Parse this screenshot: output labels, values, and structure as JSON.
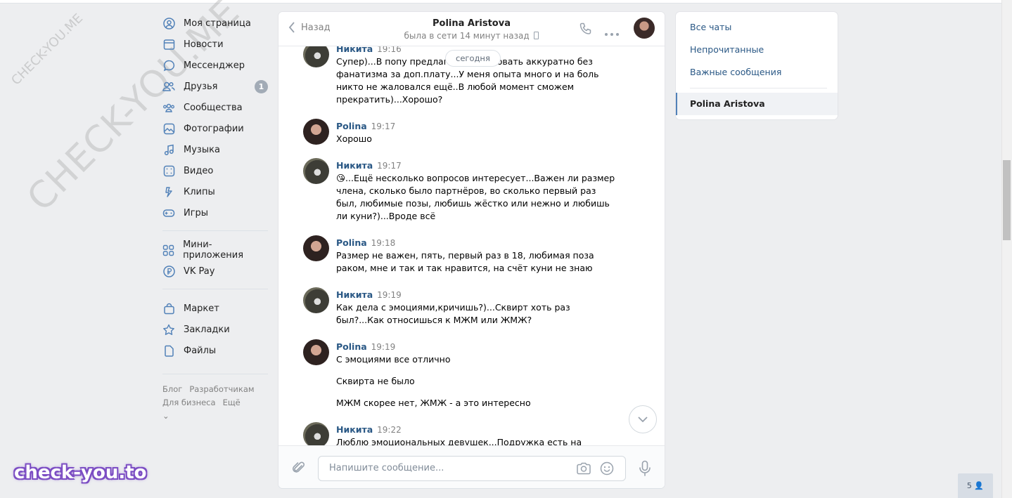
{
  "nav": {
    "items": [
      {
        "label": "Моя страница",
        "icon": "user-circle-icon"
      },
      {
        "label": "Новости",
        "icon": "newspaper-icon"
      },
      {
        "label": "Мессенджер",
        "icon": "message-icon"
      },
      {
        "label": "Друзья",
        "icon": "friends-icon",
        "badge": "1"
      },
      {
        "label": "Сообщества",
        "icon": "communities-icon"
      },
      {
        "label": "Фотографии",
        "icon": "photo-icon"
      },
      {
        "label": "Музыка",
        "icon": "music-icon"
      },
      {
        "label": "Видео",
        "icon": "video-icon"
      },
      {
        "label": "Клипы",
        "icon": "clips-icon"
      },
      {
        "label": "Игры",
        "icon": "gamepad-icon"
      }
    ],
    "items2": [
      {
        "label": "Мини-приложения",
        "icon": "apps-icon"
      },
      {
        "label": "VK Pay",
        "icon": "ruble-icon"
      }
    ],
    "items3": [
      {
        "label": "Маркет",
        "icon": "bag-icon"
      },
      {
        "label": "Закладки",
        "icon": "star-icon"
      },
      {
        "label": "Файлы",
        "icon": "file-icon"
      }
    ],
    "footer": {
      "blog": "Блог",
      "dev": "Разработчикам",
      "business": "Для бизнеса",
      "more": "Ещё"
    }
  },
  "chat": {
    "back_label": "Назад",
    "peer_name": "Polina Aristova",
    "peer_status": "была в сети 14 минут назад",
    "today_label": "сегодня",
    "messages": [
      {
        "author": "Никита",
        "time": "19:16",
        "who": "n",
        "text": [
          "Супер)...В попу предлагаю попробовать аккуратно без фанатизма за доп.плату...У меня опыта много и на боль никто не жаловался ещё..В любой момент сможем прекратить)...Хорошо?"
        ]
      },
      {
        "author": "Polina",
        "time": "19:17",
        "who": "p",
        "text": [
          "Хорошо"
        ]
      },
      {
        "author": "Никита",
        "time": "19:17",
        "who": "n",
        "text": [
          "😘...Ещё несколько вопросов интересует...Важен ли размер члена, сколько было партнёров, во сколько первый раз был, любимые позы, любишь жёстко или нежно и любишь ли куни?)...Вроде всё"
        ]
      },
      {
        "author": "Polina",
        "time": "19:18",
        "who": "p",
        "text": [
          "Размер не важен, пять, первый раз в 18, любимая поза раком, мне и так и так нравится, на счёт куни не знаю"
        ]
      },
      {
        "author": "Никита",
        "time": "19:19",
        "who": "n",
        "text": [
          "Как дела с эмоциями,кричишь?)...Сквирт хоть раз был?...Как относишься к МЖМ или ЖМЖ?"
        ]
      },
      {
        "author": "Polina",
        "time": "19:19",
        "who": "p",
        "text": [
          "С эмоциями все отлично",
          "Сквирта не было",
          "МЖМ скорее нет, ЖМЖ - а это интересно"
        ]
      },
      {
        "author": "Никита",
        "time": "19:22",
        "who": "n",
        "text": [
          "Люблю эмоциональных девушек...Подружка есть на примете"
        ]
      }
    ],
    "composer_placeholder": "Напишите сообщение..."
  },
  "right": {
    "all_chats": "Все чаты",
    "unread": "Непрочитанные",
    "important": "Важные сообщения",
    "active_chat": "Polina Aristova"
  },
  "watermark": {
    "big": "CHECK-YOU.ME",
    "small": "CHECK-YOU.ME",
    "logo": "check-you.to"
  },
  "counter": "5",
  "colors": {
    "link": "#2a5885",
    "accent": "#5181b8",
    "bg": "#edeef0"
  }
}
